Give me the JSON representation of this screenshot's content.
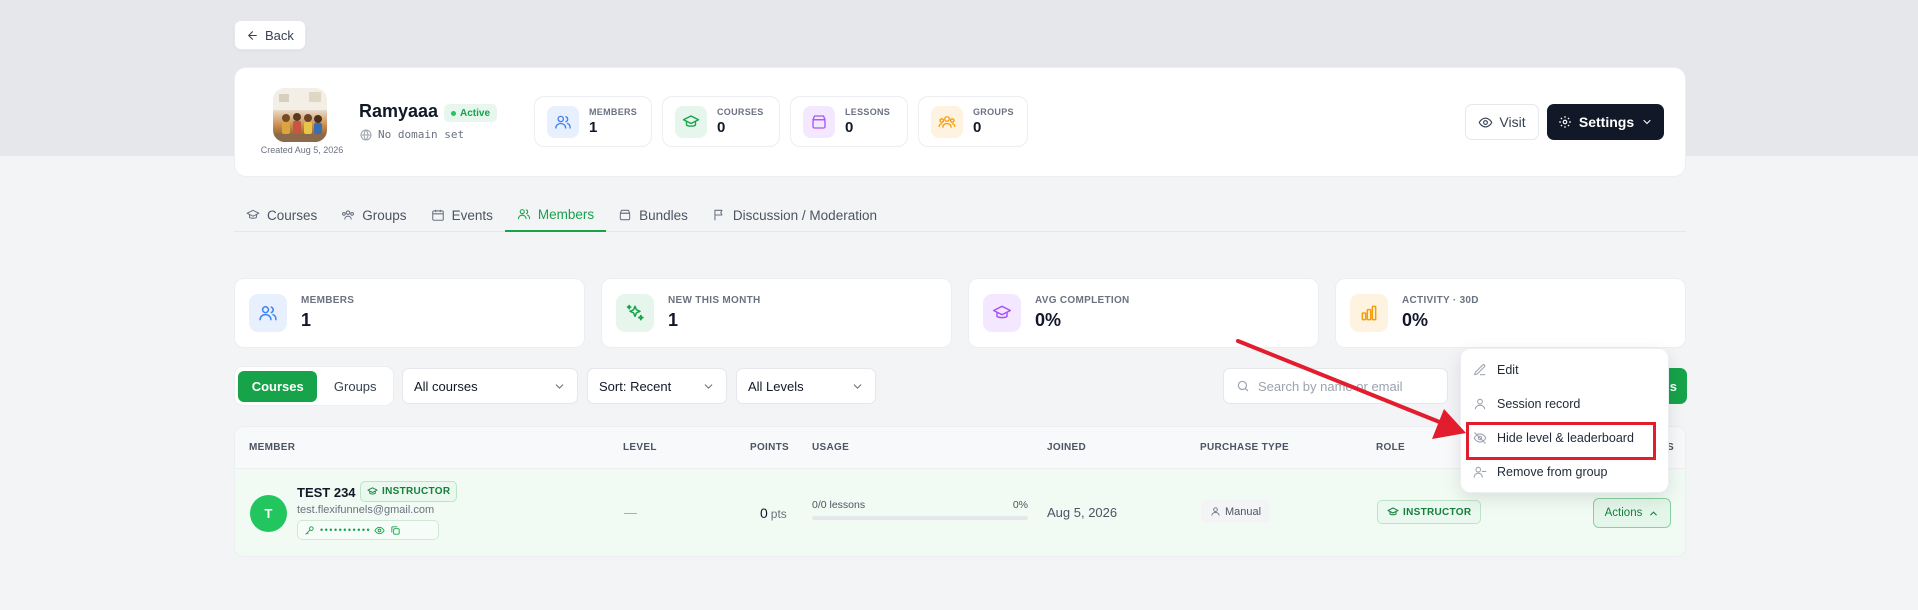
{
  "back": {
    "label": "Back"
  },
  "header": {
    "name": "Ramyaaa",
    "status": "Active",
    "domain": "No domain set",
    "created": "Created Aug 5, 2026",
    "stats": [
      {
        "label": "MEMBERS",
        "value": "1",
        "icon": "users-icon",
        "color": "#3b82f6",
        "bg": "#e8f0fe"
      },
      {
        "label": "COURSES",
        "value": "0",
        "icon": "graduation-cap-icon",
        "color": "#16a34a",
        "bg": "#e6f6ec"
      },
      {
        "label": "LESSONS",
        "value": "0",
        "icon": "archive-icon",
        "color": "#a855f7",
        "bg": "#f3e8ff"
      },
      {
        "label": "GROUPS",
        "value": "0",
        "icon": "group-icon",
        "color": "#f59e0b",
        "bg": "#fef3e0"
      }
    ],
    "visit_label": "Visit",
    "settings_label": "Settings"
  },
  "tabs": [
    {
      "label": "Courses",
      "icon": "graduation-cap-icon"
    },
    {
      "label": "Groups",
      "icon": "group-icon"
    },
    {
      "label": "Events",
      "icon": "calendar-icon"
    },
    {
      "label": "Members",
      "icon": "users-icon",
      "active": true
    },
    {
      "label": "Bundles",
      "icon": "package-icon"
    },
    {
      "label": "Discussion / Moderation",
      "icon": "flag-icon"
    }
  ],
  "metrics": [
    {
      "label": "MEMBERS",
      "value": "1",
      "icon": "users-icon",
      "color": "#3b82f6",
      "bg": "#e8f0fe"
    },
    {
      "label": "NEW THIS MONTH",
      "value": "1",
      "icon": "sparkles-icon",
      "color": "#16a34a",
      "bg": "#e6f6ec"
    },
    {
      "label": "AVG COMPLETION",
      "value": "0%",
      "icon": "graduation-cap-icon",
      "color": "#a855f7",
      "bg": "#f3e8ff"
    },
    {
      "label": "ACTIVITY · 30D",
      "value": "0%",
      "icon": "bar-chart-icon",
      "color": "#f59e0b",
      "bg": "#fef3e0"
    }
  ],
  "filters": {
    "seg_courses": "Courses",
    "seg_groups": "Groups",
    "courses_select": "All courses",
    "sort_select": "Sort: Recent",
    "levels_select": "All Levels",
    "search_placeholder": "Search by name or email",
    "green_button_tail": "s"
  },
  "table": {
    "columns": [
      "MEMBER",
      "LEVEL",
      "POINTS",
      "USAGE",
      "JOINED",
      "PURCHASE TYPE",
      "ROLE",
      "S"
    ],
    "row": {
      "avatar_letter": "T",
      "name": "TEST 234",
      "name_badge": "INSTRUCTOR",
      "email": "test.flexifunnels@gmail.com",
      "password_mask": "• • • • • • • • • • •",
      "level": "—",
      "points_value": "0",
      "points_unit": "pts",
      "usage_text": "0/0 lessons",
      "usage_percent": "0%",
      "joined": "Aug 5, 2026",
      "purchase_type": "Manual",
      "role": "INSTRUCTOR",
      "actions_label": "Actions"
    }
  },
  "menu": {
    "items": [
      {
        "label": "Edit",
        "icon": "edit-icon"
      },
      {
        "label": "Session record",
        "icon": "user-icon"
      },
      {
        "label": "Hide level & leaderboard",
        "icon": "eye-off-icon"
      },
      {
        "label": "Remove from group",
        "icon": "user-minus-icon"
      }
    ]
  },
  "colors": {
    "accent": "#16a34a",
    "dark": "#111827",
    "annotation": "#e11d2e"
  }
}
